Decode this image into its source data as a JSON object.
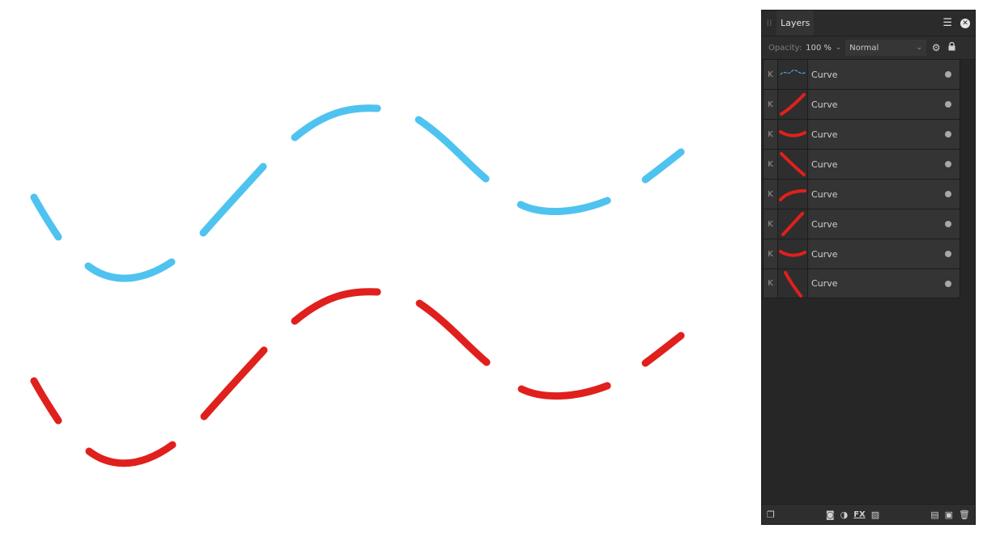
{
  "panel": {
    "tab_label": "Layers",
    "opacity_label": "Opacity:",
    "opacity_value": "100 %",
    "blend_mode": "Normal"
  },
  "layers": [
    {
      "name": "Curve",
      "thumb_color": "#4fc3f0",
      "thumb": "wave"
    },
    {
      "name": "Curve",
      "thumb_color": "#e0201c",
      "thumb": "diag-up"
    },
    {
      "name": "Curve",
      "thumb_color": "#e0201c",
      "thumb": "smile"
    },
    {
      "name": "Curve",
      "thumb_color": "#e0201c",
      "thumb": "diag-down"
    },
    {
      "name": "Curve",
      "thumb_color": "#e0201c",
      "thumb": "arc"
    },
    {
      "name": "Curve",
      "thumb_color": "#e0201c",
      "thumb": "line-up"
    },
    {
      "name": "Curve",
      "thumb_color": "#e0201c",
      "thumb": "smile"
    },
    {
      "name": "Curve",
      "thumb_color": "#e0201c",
      "thumb": "steep-down"
    }
  ],
  "colors": {
    "blue_curve": "#4fc3f0",
    "red_curve": "#e0201c",
    "panel_bg": "#262626"
  },
  "icons": {
    "header": [
      "grip-icon",
      "menu-icon",
      "close-icon"
    ],
    "toolbar": [
      "gear-icon",
      "lock-icon"
    ],
    "footer": [
      "layer-stack-icon",
      "mask-icon",
      "adjustment-icon",
      "fx-icon",
      "live-filter-icon",
      "add-layer-icon",
      "group-icon",
      "trash-icon"
    ]
  }
}
